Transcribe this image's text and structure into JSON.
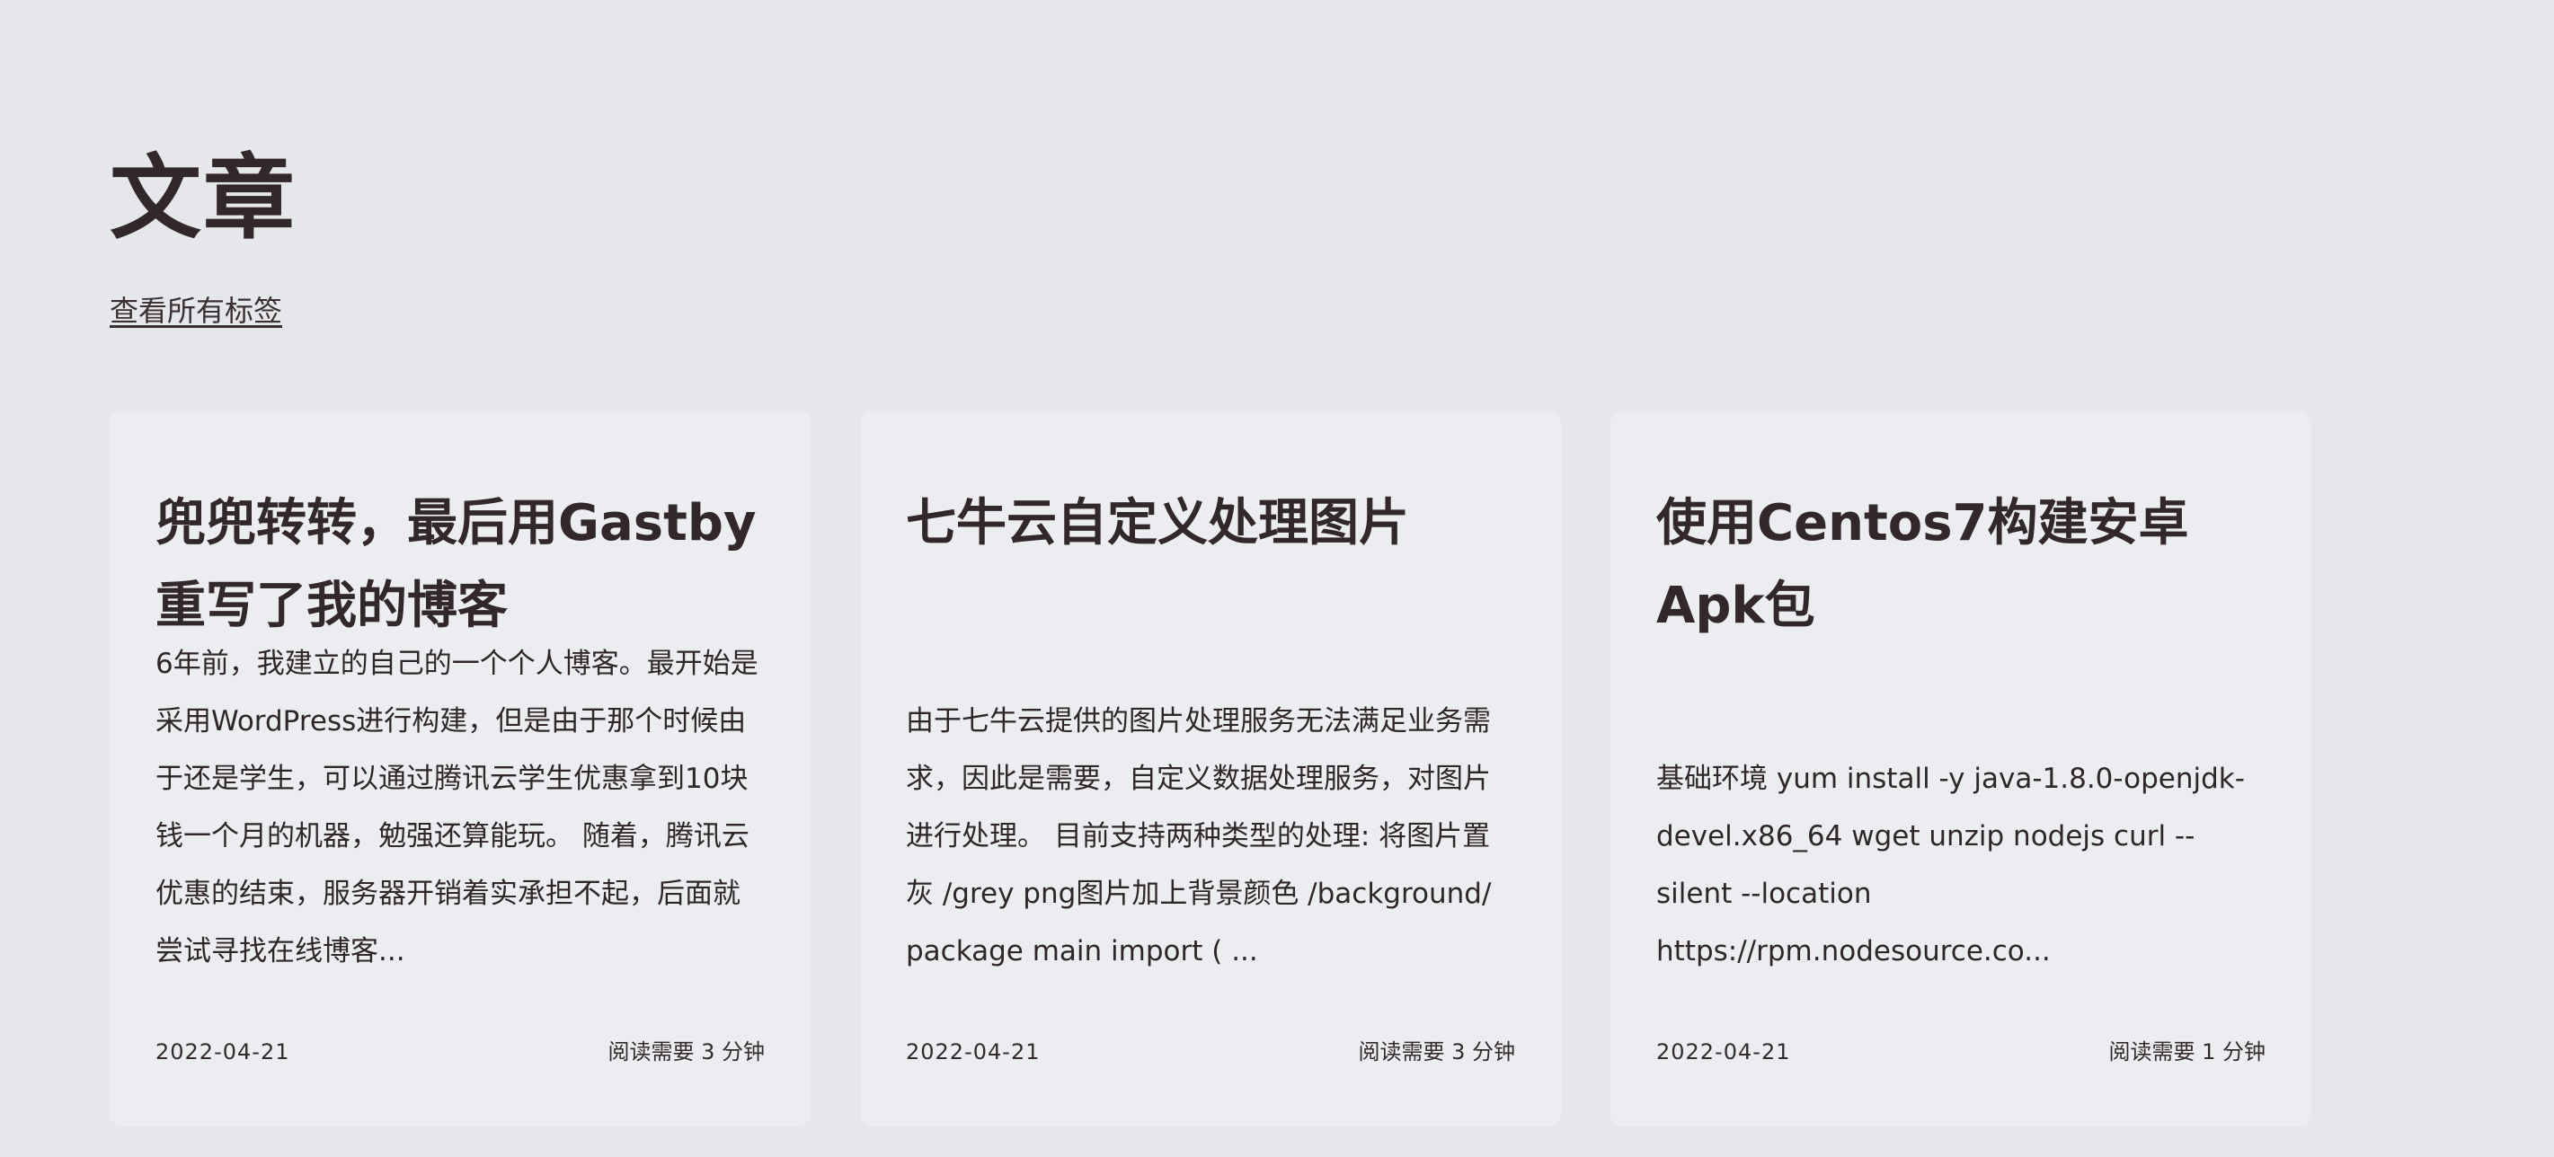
{
  "header": {
    "title": "文章",
    "tags_link": "查看所有标签"
  },
  "articles": [
    {
      "title": "兜兜转转，最后用Gastby重写了我的博客",
      "excerpt": "6年前，我建立的自己的一个个人博客。最开始是采用WordPress进行构建，但是由于那个时候由于还是学生，可以通过腾讯云学生优惠拿到10块钱一个月的机器，勉强还算能玩。 随着，腾讯云优惠的结束，服务器开销着实承担不起，后面就尝试寻找在线博客...",
      "date": "2022-04-21",
      "read_time": "阅读需要 3 分钟"
    },
    {
      "title": "七牛云自定义处理图片",
      "excerpt": "由于七牛云提供的图片处理服务无法满足业务需求，因此是需要，自定义数据处理服务，对图片进行处理。 目前支持两种类型的处理: 将图片置灰 /grey png图片加上背景颜色 /background/ package main import ( ...",
      "date": "2022-04-21",
      "read_time": "阅读需要 3 分钟"
    },
    {
      "title": "使用Centos7构建安卓Apk包",
      "excerpt": "基础环境 yum install -y java-1.8.0-openjdk-devel.x86_64 wget unzip nodejs curl --silent --location https://rpm.nodesource.co...",
      "date": "2022-04-21",
      "read_time": "阅读需要 1 分钟"
    }
  ],
  "colors": {
    "background": "#e6e7eb",
    "card": "#ecedf1",
    "text": "#322729"
  }
}
